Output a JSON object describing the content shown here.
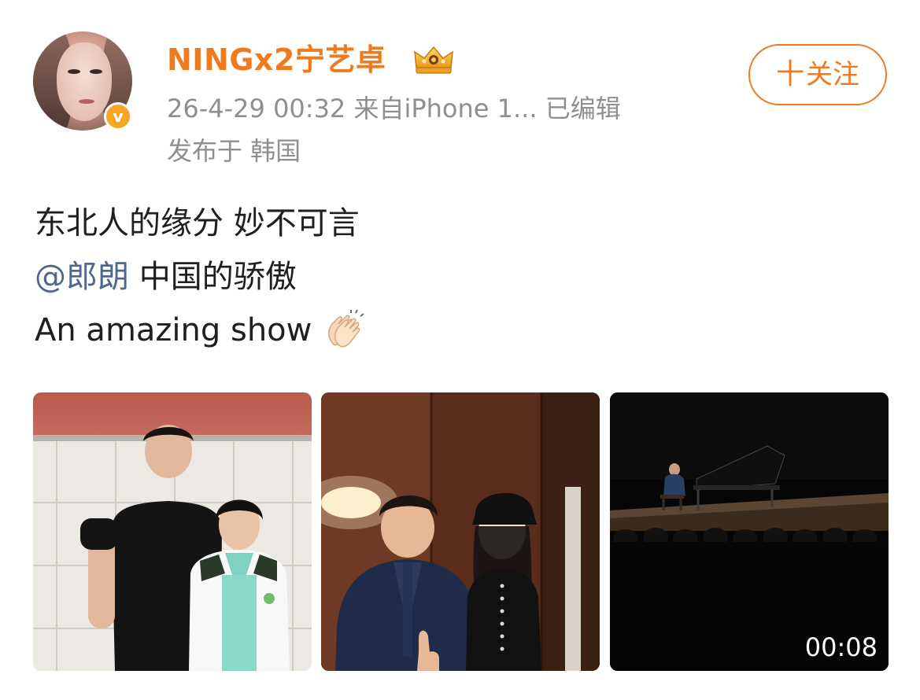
{
  "header": {
    "username": "NINGx2宁艺卓",
    "meta": "26-4-29 00:32  来自iPhone 1...  已编辑",
    "location": "发布于 韩国",
    "follow_label": "关注",
    "follow_plus": "十",
    "verified_icon": "verified-v-icon",
    "verified_mark": "v",
    "crown_icon": "gold-crown-badge-icon"
  },
  "post": {
    "line1": "东北人的缘分 妙不可言",
    "mention": "@郎朗",
    "line2_rest": " 中国的骄傲",
    "line3": "An amazing show",
    "emoji": "clapping-hands-emoji"
  },
  "media": {
    "video_duration": "00:08"
  },
  "colors": {
    "brand_orange": "#f07a1e",
    "mention_blue": "#50688c",
    "meta_grey": "#8e8e93",
    "verified_badge": "#f5a623"
  }
}
